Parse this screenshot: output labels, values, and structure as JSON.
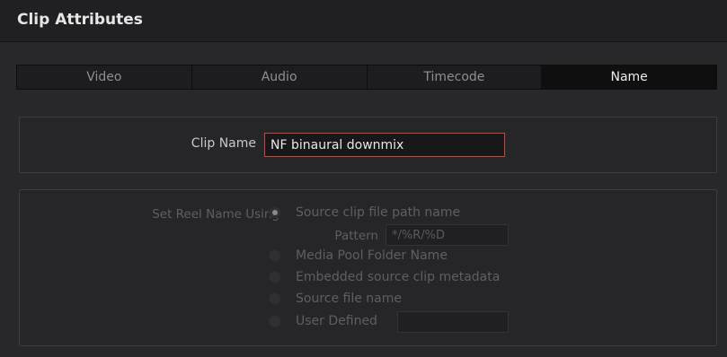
{
  "window": {
    "title": "Clip Attributes"
  },
  "tabs": [
    {
      "label": "Video",
      "active": false
    },
    {
      "label": "Audio",
      "active": false
    },
    {
      "label": "Timecode",
      "active": false
    },
    {
      "label": "Name",
      "active": true
    }
  ],
  "clip_name": {
    "label": "Clip Name",
    "value": "NF binaural downmix"
  },
  "reel": {
    "label": "Set Reel Name Using",
    "options": [
      {
        "label": "Source clip file path name",
        "checked": true
      },
      {
        "label": "Media Pool Folder Name",
        "checked": false
      },
      {
        "label": "Embedded source clip metadata",
        "checked": false
      },
      {
        "label": "Source file name",
        "checked": false
      },
      {
        "label": "User Defined",
        "checked": false
      }
    ],
    "pattern_label": "Pattern",
    "pattern_value": "*/%R/%D",
    "user_defined_value": ""
  },
  "colors": {
    "accent_border": "#d0433a",
    "background": "#28282b"
  }
}
